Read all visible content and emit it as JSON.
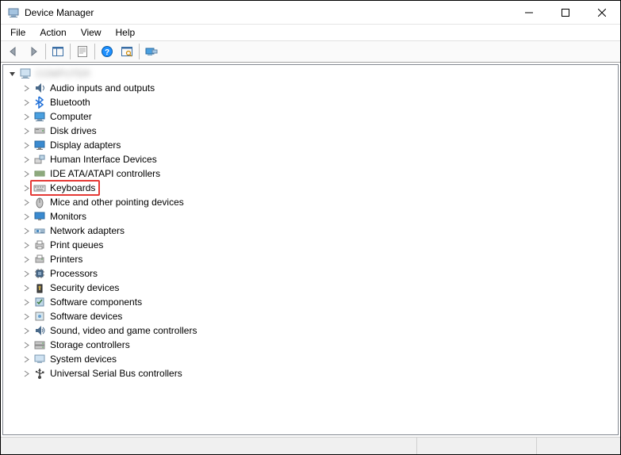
{
  "window": {
    "title": "Device Manager"
  },
  "menu": {
    "file": "File",
    "action": "Action",
    "view": "View",
    "help": "Help"
  },
  "tree": {
    "root": "COMPUTER",
    "items": [
      {
        "icon": "audio-icon",
        "label": "Audio inputs and outputs"
      },
      {
        "icon": "bluetooth-icon",
        "label": "Bluetooth"
      },
      {
        "icon": "computer-icon",
        "label": "Computer"
      },
      {
        "icon": "disk-icon",
        "label": "Disk drives"
      },
      {
        "icon": "display-icon",
        "label": "Display adapters"
      },
      {
        "icon": "hid-icon",
        "label": "Human Interface Devices"
      },
      {
        "icon": "ide-icon",
        "label": "IDE ATA/ATAPI controllers"
      },
      {
        "icon": "keyboard-icon",
        "label": "Keyboards",
        "highlight": true
      },
      {
        "icon": "mouse-icon",
        "label": "Mice and other pointing devices"
      },
      {
        "icon": "monitor-icon",
        "label": "Monitors"
      },
      {
        "icon": "network-icon",
        "label": "Network adapters"
      },
      {
        "icon": "printqueue-icon",
        "label": "Print queues"
      },
      {
        "icon": "printer-icon",
        "label": "Printers"
      },
      {
        "icon": "processor-icon",
        "label": "Processors"
      },
      {
        "icon": "security-icon",
        "label": "Security devices"
      },
      {
        "icon": "swcomp-icon",
        "label": "Software components"
      },
      {
        "icon": "swdev-icon",
        "label": "Software devices"
      },
      {
        "icon": "sound-icon",
        "label": "Sound, video and game controllers"
      },
      {
        "icon": "storage-icon",
        "label": "Storage controllers"
      },
      {
        "icon": "system-icon",
        "label": "System devices"
      },
      {
        "icon": "usb-icon",
        "label": "Universal Serial Bus controllers"
      }
    ]
  }
}
